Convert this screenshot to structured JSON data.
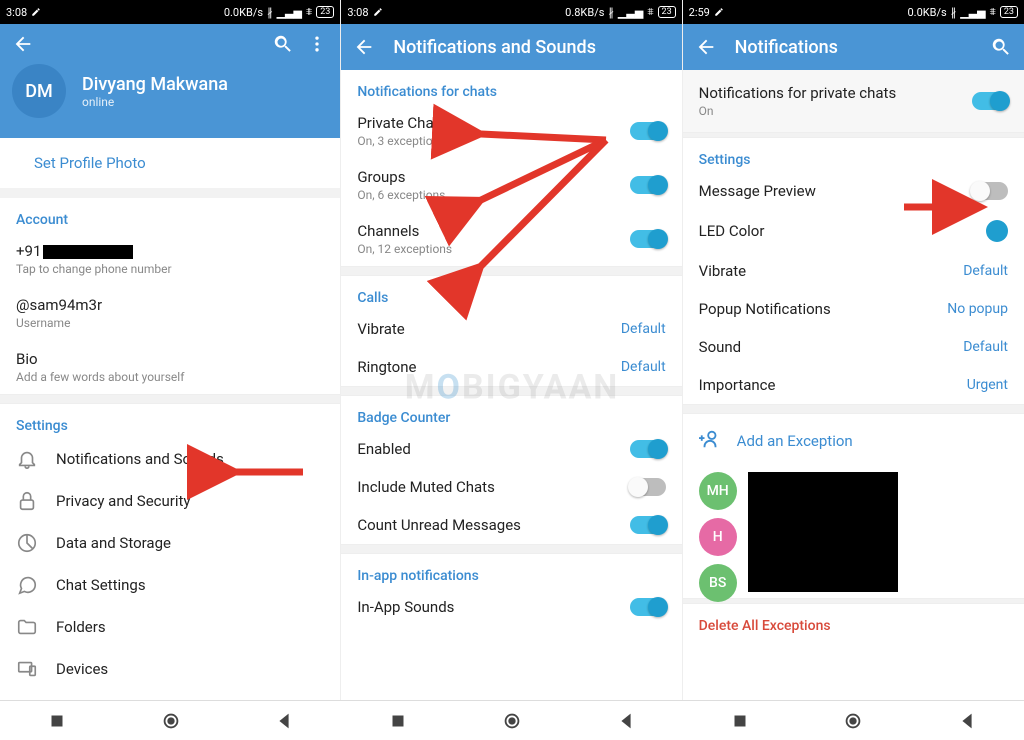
{
  "status": {
    "s1_time": "3:08",
    "s1_net": "0.0KB/s",
    "s1_batt": "23",
    "s2_time": "3:08",
    "s2_net": "0.8KB/s",
    "s2_batt": "23",
    "s3_time": "2:59",
    "s3_net": "0.0KB/s",
    "s3_batt": "23",
    "bt_icon": "✱",
    "sig_icon": "▁▂▃▅",
    "wifi_icon": "⩕"
  },
  "screen1": {
    "avatar_initials": "DM",
    "name": "Divyang Makwana",
    "status": "online",
    "set_photo": "Set Profile Photo",
    "account_title": "Account",
    "phone_prefix": "+91",
    "phone_sub": "Tap to change phone number",
    "username": "@sam94m3r",
    "username_sub": "Username",
    "bio_title": "Bio",
    "bio_sub": "Add a few words about yourself",
    "settings_title": "Settings",
    "rows": {
      "notifications": "Notifications and Sounds",
      "privacy": "Privacy and Security",
      "data": "Data and Storage",
      "chat": "Chat Settings",
      "folders": "Folders",
      "devices": "Devices"
    }
  },
  "screen2": {
    "title": "Notifications and Sounds",
    "section_chats": "Notifications for chats",
    "private_title": "Private Chats",
    "private_sub": "On, 3 exceptions",
    "groups_title": "Groups",
    "groups_sub": "On, 6 exceptions",
    "channels_title": "Channels",
    "channels_sub": "On, 12 exceptions",
    "section_calls": "Calls",
    "vibrate_title": "Vibrate",
    "vibrate_value": "Default",
    "ringtone_title": "Ringtone",
    "ringtone_value": "Default",
    "section_badge": "Badge Counter",
    "enabled_title": "Enabled",
    "muted_title": "Include Muted Chats",
    "unread_title": "Count Unread Messages",
    "section_inapp": "In-app notifications",
    "inapp_sounds": "In-App Sounds"
  },
  "screen3": {
    "title": "Notifications",
    "header_row": "Notifications for private chats",
    "header_sub": "On",
    "section_settings": "Settings",
    "msg_preview": "Message Preview",
    "led": "LED Color",
    "vibrate": "Vibrate",
    "vibrate_v": "Default",
    "popup": "Popup Notifications",
    "popup_v": "No popup",
    "sound": "Sound",
    "sound_v": "Default",
    "importance": "Importance",
    "importance_v": "Urgent",
    "add_ex": "Add an Exception",
    "ex1_initials": "MH",
    "ex2_initials": "H",
    "ex3_initials": "BS",
    "delete_ex": "Delete All Exceptions"
  },
  "watermark_a": "M",
  "watermark_b": "O",
  "watermark_c": "BIGYAAN"
}
